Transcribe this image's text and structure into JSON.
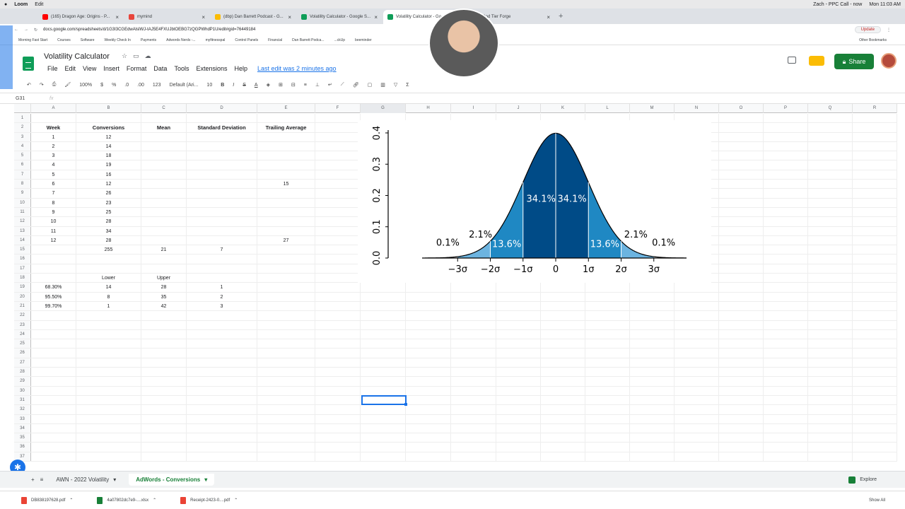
{
  "mac_menubar": {
    "apple": "",
    "app": "Loom",
    "edit": "Edit",
    "user": "Zach - PPC Call - now",
    "time": "Mon 11:03 AM"
  },
  "browser": {
    "tabs": [
      {
        "label": "(165) Dragon Age: Origins - P..."
      },
      {
        "label": "mymind"
      },
      {
        "label": "(dbp) Dan Barrett Podcast - G..."
      },
      {
        "label": "Volatility Calculator - Google S..."
      },
      {
        "label": "Volatility Calculator - Go..."
      },
      {
        "label": "God Tier Forge"
      }
    ],
    "url": "docs.google.com/spreadsheets/d/1G3I3CGEdwAlslWJ-tAJ5E4FXUJbtOEBG7zQGPWhdP1U/edit#gid=76449184",
    "update_label": "Update",
    "bookmarks": [
      "Morning Fast Start",
      "Courses",
      "Software",
      "Weekly Check In",
      "Payments",
      "Adwords Nerds -...",
      "myfitnesspal",
      "Control Panels",
      "Financial",
      "Dan Barrett Podca...",
      "...ckUp",
      "beeminder"
    ],
    "other_bookmarks": "Other Bookmarks"
  },
  "doc": {
    "title": "Volatility Calculator",
    "menus": [
      "File",
      "Edit",
      "View",
      "Insert",
      "Format",
      "Data",
      "Tools",
      "Extensions",
      "Help"
    ],
    "last_edit": "Last edit was 2 minutes ago",
    "share_label": "Share"
  },
  "toolbar": {
    "zoom": "100%",
    "currency": "$",
    "percent": "%",
    "dec_less": ".0",
    "dec_more": ".00",
    "format": "123",
    "font": "Default (Ari...",
    "size": "10",
    "bold": "B",
    "italic": "I",
    "strike": "S",
    "color": "A"
  },
  "formula_bar": {
    "cell": "G31",
    "fx": "fx",
    "value": ""
  },
  "columns": [
    "A",
    "B",
    "C",
    "D",
    "E",
    "F",
    "G",
    "H",
    "I",
    "J",
    "K",
    "L",
    "M",
    "N",
    "O",
    "P",
    "Q",
    "R"
  ],
  "rows": [
    {
      "n": "1",
      "cells": [
        "",
        "",
        "",
        "",
        ""
      ]
    },
    {
      "n": "2",
      "cells": [
        "Week",
        "Conversions",
        "Mean",
        "Standard Deviation",
        "Trailing Average"
      ],
      "header": true
    },
    {
      "n": "3",
      "cells": [
        "1",
        "12",
        "",
        "",
        ""
      ]
    },
    {
      "n": "4",
      "cells": [
        "2",
        "14",
        "",
        "",
        ""
      ]
    },
    {
      "n": "5",
      "cells": [
        "3",
        "18",
        "",
        "",
        ""
      ]
    },
    {
      "n": "6",
      "cells": [
        "4",
        "19",
        "",
        "",
        ""
      ]
    },
    {
      "n": "7",
      "cells": [
        "5",
        "16",
        "",
        "",
        ""
      ]
    },
    {
      "n": "8",
      "cells": [
        "6",
        "12",
        "",
        "",
        "15"
      ]
    },
    {
      "n": "9",
      "cells": [
        "7",
        "26",
        "",
        "",
        ""
      ]
    },
    {
      "n": "10",
      "cells": [
        "8",
        "23",
        "",
        "",
        ""
      ]
    },
    {
      "n": "11",
      "cells": [
        "9",
        "25",
        "",
        "",
        ""
      ]
    },
    {
      "n": "12",
      "cells": [
        "10",
        "28",
        "",
        "",
        ""
      ]
    },
    {
      "n": "13",
      "cells": [
        "11",
        "34",
        "",
        "",
        ""
      ]
    },
    {
      "n": "14",
      "cells": [
        "12",
        "28",
        "",
        "",
        "27"
      ]
    },
    {
      "n": "15",
      "cells": [
        "",
        "255",
        "21",
        "7",
        ""
      ]
    },
    {
      "n": "16",
      "cells": [
        "",
        "",
        "",
        "",
        ""
      ]
    },
    {
      "n": "17",
      "cells": [
        "",
        "",
        "",
        "",
        ""
      ]
    },
    {
      "n": "18",
      "cells": [
        "",
        "Lower",
        "Upper",
        "",
        ""
      ]
    },
    {
      "n": "19",
      "cells": [
        "68.30%",
        "14",
        "28",
        "1",
        ""
      ]
    },
    {
      "n": "20",
      "cells": [
        "95.50%",
        "8",
        "35",
        "2",
        ""
      ]
    },
    {
      "n": "21",
      "cells": [
        "99.70%",
        "1",
        "42",
        "3",
        ""
      ]
    },
    {
      "n": "22",
      "cells": [
        "",
        "",
        "",
        "",
        ""
      ]
    },
    {
      "n": "23",
      "cells": [
        "",
        "",
        "",
        "",
        ""
      ]
    },
    {
      "n": "24",
      "cells": [
        "",
        "",
        "",
        "",
        ""
      ]
    },
    {
      "n": "25",
      "cells": [
        "",
        "",
        "",
        "",
        ""
      ]
    },
    {
      "n": "26",
      "cells": [
        "",
        "",
        "",
        "",
        ""
      ]
    },
    {
      "n": "27",
      "cells": [
        "",
        "",
        "",
        "",
        ""
      ]
    },
    {
      "n": "28",
      "cells": [
        "",
        "",
        "",
        "",
        ""
      ]
    },
    {
      "n": "29",
      "cells": [
        "",
        "",
        "",
        "",
        ""
      ]
    },
    {
      "n": "30",
      "cells": [
        "",
        "",
        "",
        "",
        ""
      ]
    },
    {
      "n": "31",
      "cells": [
        "",
        "",
        "",
        "",
        ""
      ]
    },
    {
      "n": "32",
      "cells": [
        "",
        "",
        "",
        "",
        ""
      ]
    },
    {
      "n": "33",
      "cells": [
        "",
        "",
        "",
        "",
        ""
      ]
    },
    {
      "n": "34",
      "cells": [
        "",
        "",
        "",
        "",
        ""
      ]
    },
    {
      "n": "35",
      "cells": [
        "",
        "",
        "",
        "",
        ""
      ]
    },
    {
      "n": "36",
      "cells": [
        "",
        "",
        "",
        "",
        ""
      ]
    },
    {
      "n": "37",
      "cells": [
        "",
        "",
        "",
        "",
        ""
      ]
    }
  ],
  "chart_data": {
    "type": "area",
    "title": "",
    "yticks": [
      "0.0",
      "0.1",
      "0.2",
      "0.3",
      "0.4"
    ],
    "xticks": [
      "−3σ",
      "−2σ",
      "−1σ",
      "0",
      "1σ",
      "2σ",
      "3σ"
    ],
    "ylim": [
      0,
      0.4
    ],
    "xlim": [
      -4,
      4
    ],
    "region_labels": [
      {
        "text": "0.1%",
        "x": -3.3,
        "y": 0.04
      },
      {
        "text": "2.1%",
        "x": -2.3,
        "y": 0.065
      },
      {
        "text": "13.6%",
        "x": -1.5,
        "y": 0.035
      },
      {
        "text": "34.1%",
        "x": -0.45,
        "y": 0.18
      },
      {
        "text": "34.1%",
        "x": 0.5,
        "y": 0.18
      },
      {
        "text": "13.6%",
        "x": 1.5,
        "y": 0.035
      },
      {
        "text": "2.1%",
        "x": 2.45,
        "y": 0.065
      },
      {
        "text": "0.1%",
        "x": 3.3,
        "y": 0.04
      }
    ],
    "colors": {
      "center": "#004b87",
      "mid": "#1f88c3",
      "tail": "#6cb4e0"
    }
  },
  "sheet_tabs": [
    {
      "label": "AWN - 2022 Volatility"
    },
    {
      "label": "AdWords - Conversions"
    }
  ],
  "explore": "Explore",
  "downloads": [
    {
      "label": "DB8381976​28.pdf"
    },
    {
      "label": "4a07802dc7e9-....xlsx"
    },
    {
      "label": "Receipt-2423-0....pdf"
    }
  ],
  "show_all": "Show All"
}
